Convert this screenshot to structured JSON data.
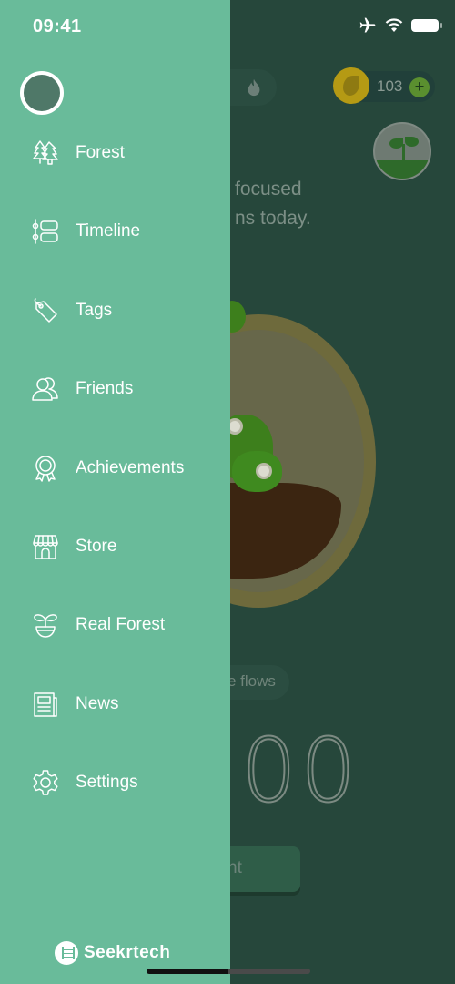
{
  "status_bar": {
    "time": "09:41",
    "icons": [
      "airplane-icon",
      "wifi-icon",
      "battery-icon"
    ]
  },
  "drawer": {
    "avatar": "profile-avatar",
    "items": [
      {
        "label": "Forest",
        "icon": "forest-icon"
      },
      {
        "label": "Timeline",
        "icon": "timeline-icon"
      },
      {
        "label": "Tags",
        "icon": "tag-icon"
      },
      {
        "label": "Friends",
        "icon": "friends-icon"
      },
      {
        "label": "Achievements",
        "icon": "achievement-icon"
      },
      {
        "label": "Store",
        "icon": "store-icon"
      },
      {
        "label": "Real Forest",
        "icon": "sprout-icon"
      },
      {
        "label": "News",
        "icon": "news-icon"
      },
      {
        "label": "Settings",
        "icon": "gear-icon"
      }
    ],
    "brand": "Seekrtech"
  },
  "background": {
    "coins": "103",
    "headline_line1": "focused",
    "headline_line2": "ns today.",
    "flows_text": "e flows",
    "timer": "00",
    "plant_button": "nt"
  },
  "colors": {
    "drawer_bg": "#69bb9a",
    "overlay_bg": "#26473b",
    "coin": "#b59a14"
  }
}
